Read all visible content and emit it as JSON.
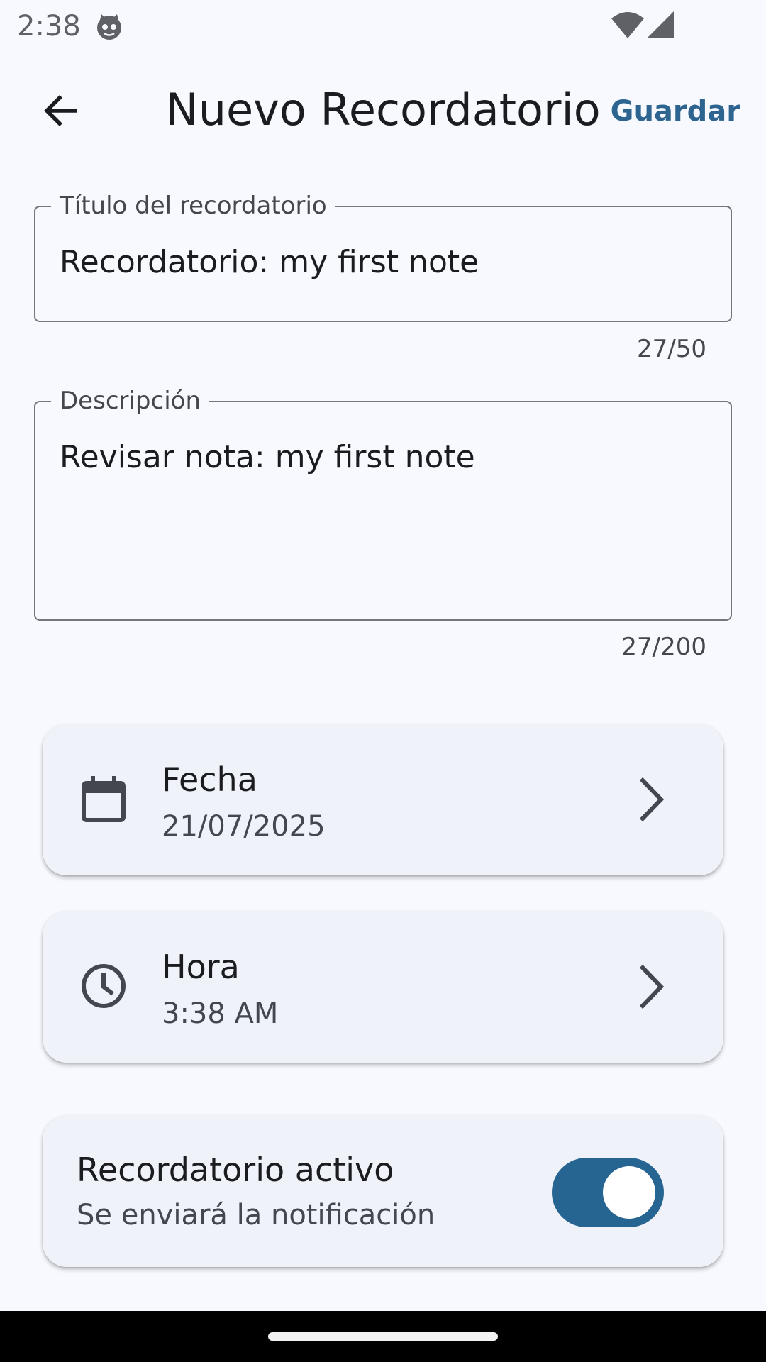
{
  "status_bar": {
    "time": "2:38"
  },
  "app_bar": {
    "title": "Nuevo Recordatorio",
    "save_label": "Guardar"
  },
  "title_field": {
    "label": "Título del recordatorio",
    "value": "Recordatorio: my first note",
    "counter": "27/50"
  },
  "description_field": {
    "label": "Descripción",
    "value": "Revisar nota: my first note",
    "counter": "27/200"
  },
  "date_card": {
    "title": "Fecha",
    "value": "21/07/2025"
  },
  "time_card": {
    "title": "Hora",
    "value": "3:38 AM"
  },
  "active_card": {
    "title": "Recordatorio activo",
    "subtitle": "Se enviará la notificación",
    "switch_on": true
  },
  "colors": {
    "accent": "#2e6590",
    "switch_track": "#266591",
    "background": "#f7f9fe",
    "card": "#eff2f9"
  }
}
